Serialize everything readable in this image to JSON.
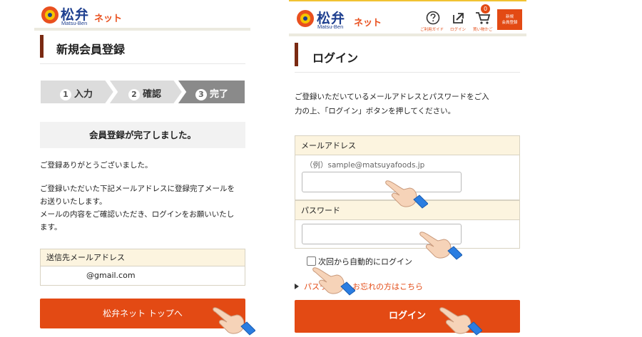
{
  "left_panel": {
    "brand": {
      "kanji": "松弁",
      "romaji": "Matsu-Ben",
      "net": "ネット"
    },
    "page_title": "新規会員登録",
    "steps": [
      {
        "num": "1",
        "label": "入力"
      },
      {
        "num": "2",
        "label": "確認"
      },
      {
        "num": "3",
        "label": "完了"
      }
    ],
    "notice": "会員登録が完了しました。",
    "thanks": "ご登録ありがとうございました。",
    "message_line1": "ご登録いただいた下記メールアドレスに登録完了メールを",
    "message_line2": "お送りいたします。",
    "message_line3": "メールの内容をご確認いただき、ログインをお願いいたし",
    "message_line4": "ます。",
    "email_label": "送信先メールアドレス",
    "email_value": "@gmail.com",
    "top_button": "松弁ネット トップへ"
  },
  "right_panel": {
    "brand": {
      "kanji": "松弁",
      "romaji": "Matsu-Ben",
      "net": "ネット"
    },
    "nav": {
      "guide": "ご利用ガイド",
      "login": "ログイン",
      "cart": "買い物かご",
      "cart_count": "0",
      "signup_line1": "新規",
      "signup_line2": "会員登録"
    },
    "page_title": "ログイン",
    "intro_line1": "ご登録いただいているメールアドレスとパスワードをご入",
    "intro_line2": "力の上、「ログイン」ボタンを押してください。",
    "email_label": "メールアドレス",
    "email_example": "（例）sample@matsuyafoods.jp",
    "password_label": "パスワード",
    "auto_login": "次回から自動的にログイン",
    "forgot_prefix": "パスワ",
    "forgot_suffix": "お忘れの方はこちら",
    "login_button": "ログイン"
  },
  "colors": {
    "accent": "#e34a14",
    "brand_blue": "#1e3f8f",
    "title_bar": "#7a2a12",
    "label_bg": "#fcf4df"
  },
  "icons": [
    "hand-pointer-icon",
    "question-icon",
    "login-icon",
    "cart-icon",
    "triangle-icon"
  ]
}
